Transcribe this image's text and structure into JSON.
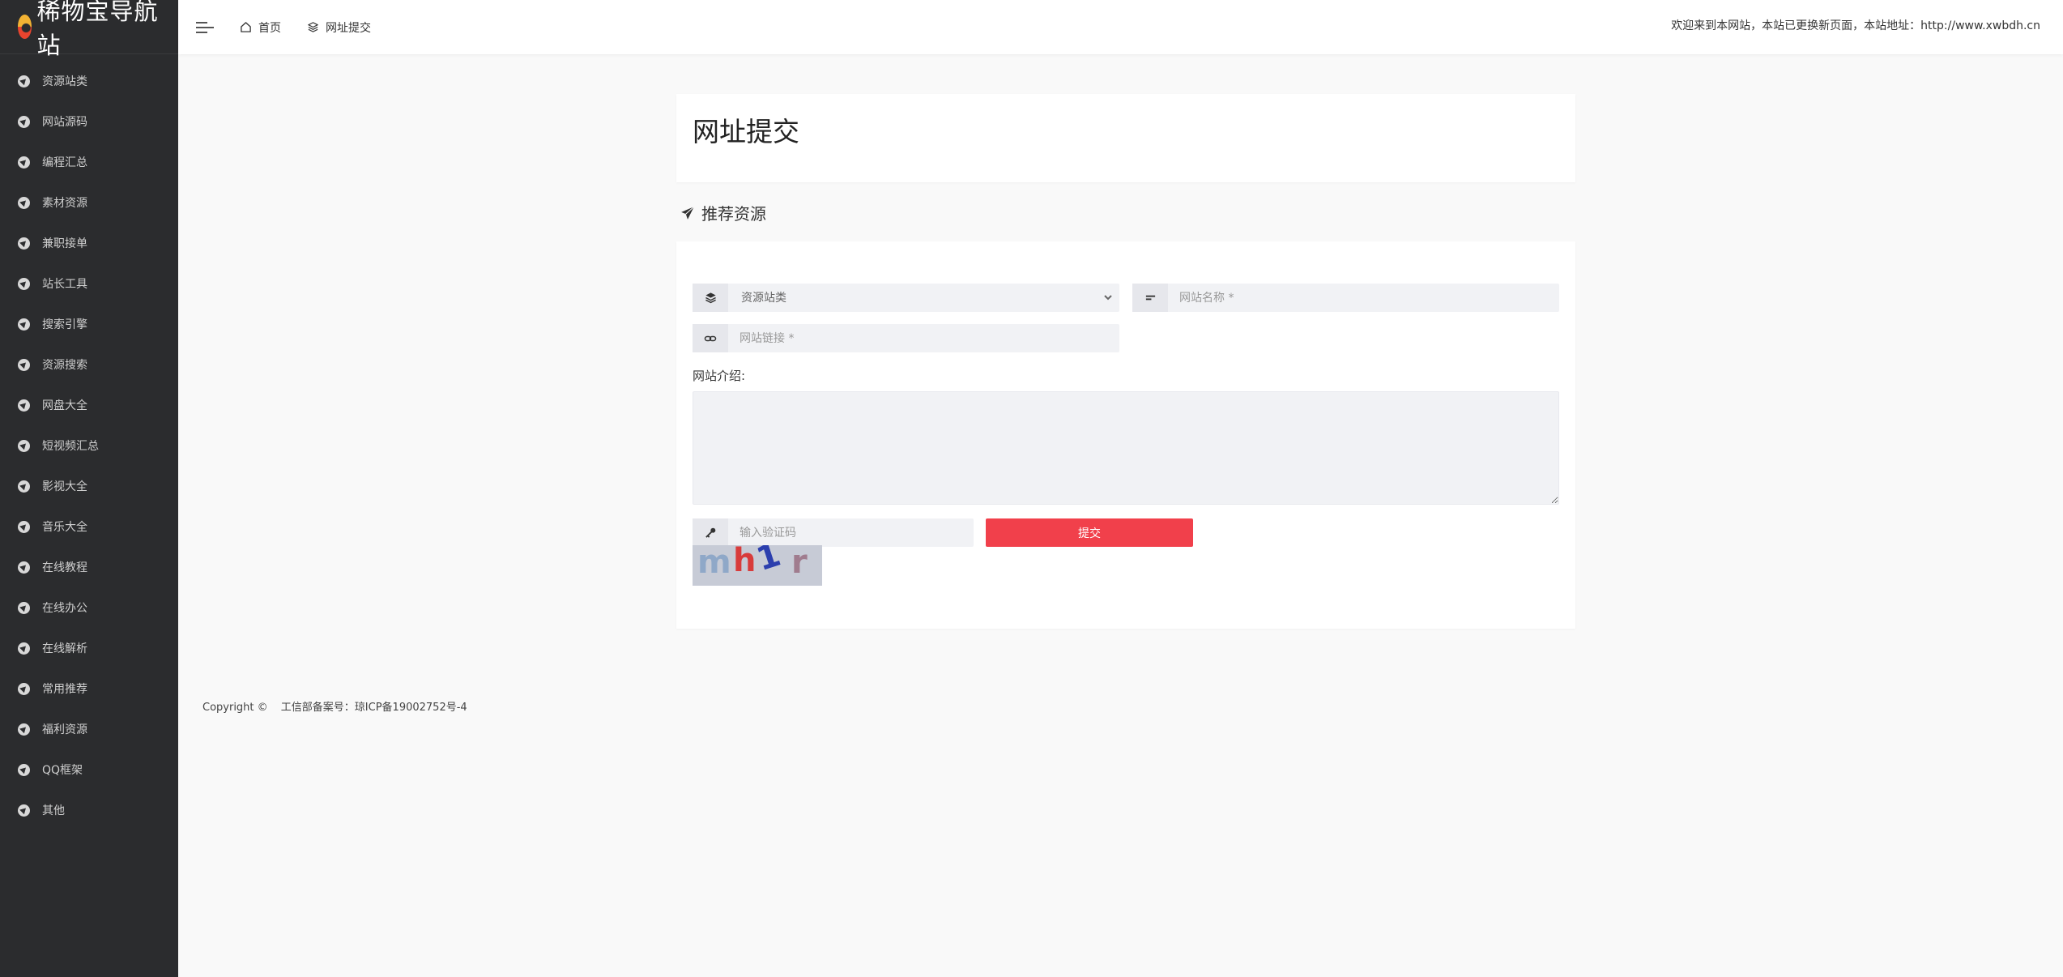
{
  "brand": {
    "name": "稀物宝导航站"
  },
  "sidebar": {
    "items": [
      {
        "label": "资源站类"
      },
      {
        "label": "网站源码"
      },
      {
        "label": "编程汇总"
      },
      {
        "label": "素材资源"
      },
      {
        "label": "兼职接单"
      },
      {
        "label": "站长工具"
      },
      {
        "label": "搜索引擎"
      },
      {
        "label": "资源搜索"
      },
      {
        "label": "网盘大全"
      },
      {
        "label": "短视频汇总"
      },
      {
        "label": "影视大全"
      },
      {
        "label": "音乐大全"
      },
      {
        "label": "在线教程"
      },
      {
        "label": "在线办公"
      },
      {
        "label": "在线解析"
      },
      {
        "label": "常用推荐"
      },
      {
        "label": "福利资源"
      },
      {
        "label": "QQ框架"
      },
      {
        "label": "其他"
      }
    ]
  },
  "header": {
    "nav_home": "首页",
    "nav_submit": "网址提交",
    "welcome": "欢迎来到本网站，本站已更换新页面，本站地址：http://www.xwbdh.cn"
  },
  "page": {
    "title": "网址提交",
    "section_title": "推荐资源"
  },
  "form": {
    "category_selected": "资源站类",
    "name_placeholder": "网站名称 *",
    "link_placeholder": "网站链接 *",
    "intro_label": "网站介绍:",
    "captcha_placeholder": "输入验证码",
    "captcha_text": [
      "m",
      "h",
      "1",
      "r"
    ],
    "submit_label": "提交"
  },
  "footer": {
    "copyright": "Copyright ©",
    "icp": "工信部备案号：琼ICP备19002752号-4"
  },
  "colors": {
    "sidebar_bg": "#2b2c2e",
    "accent": "#f1404b",
    "field_bg": "#f1f2f5"
  }
}
